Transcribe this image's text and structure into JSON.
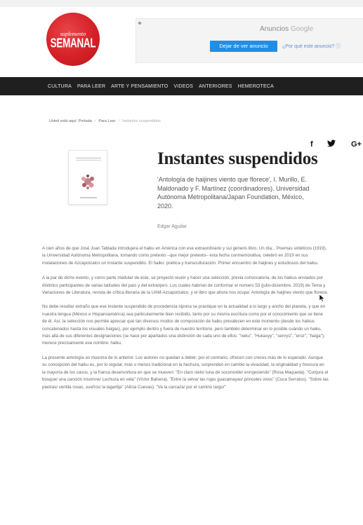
{
  "header": {
    "logo_sup": "suplemento",
    "logo_main": "SEMANAL"
  },
  "ad": {
    "title_prefix": "Anuncios ",
    "title_brand": "Google",
    "stop_button": "Dejar de ver anuncio",
    "why_link": "¿Por qué este anuncio? ⓘ"
  },
  "nav": {
    "items": [
      "CULTURA",
      "PARA LEER",
      "ARTE Y PENSAMIENTO",
      "VIDEOS",
      "ANTERIORES",
      "HEMEROTECA"
    ]
  },
  "breadcrumb": {
    "prefix": "Usted está aquí: Portada",
    "level1": "Para Leer",
    "current": "Instantes suspendidos"
  },
  "social": {
    "facebook": "f",
    "google_plus": "G+"
  },
  "article": {
    "title": "Instantes suspendidos",
    "subtitle": "'Antología de haijines viento que florece', I. Murillo, E. Maldonado y F. Martínez (coordinadores). Universidad Autónoma Metropolitana/Japan Foundation, México, 2020.",
    "author": "Edgar Aguilar",
    "paragraphs": [
      "A cien años de que José Juan Tablada introdujera el haiku en América con ese extraordinario y sui géneris libro, Un día... Poemas sintéticos (1919), la Universidad Autónoma Metropolitana, tomando como pretexto –que mejor pretexto– esta fecha conmemorativa, celebró en 2019 en sus instalaciones de Azcapotzalco un instante suspendido. El haiku: poética y transculturación. Primer encuentro de haijines y estudiosos del haiku.",
      "A la par de dicho evento, y como parte medular de éste, se proyectó reunir y hacer una selección, previa convocatoria, de los haikus enviados por distintos participantes de varias latitudes del país y del extranjero. Los cuales habrían de conformar el número 53 (julio-diciembre, 2019) de Tema y Variaciones de Literatura, revista de crítica literaria de la UAM-Azcapotzalco, y el libro que ahora nos ocupa: Antología de haijines viento que florece.",
      "No debe resultar extraño que ese instante suspendido de procedencia nipona se practique en la actualidad a lo largo y ancho del planeta, y que en nuestra lengua (México e Hispanoamérica) sea particularmente bien recibido, tanto por su misma escritura como por el conocimiento que se tiene de él. Así, la selección nos permite apreciar qué tan diversos modos de composición de haiku prevalecen en este momento (desde los haikus concatenados hasta los visuales haigas), por ejemplo dentro y fuera de nuestro territorio, pero también determinar en lo posible cuándo un haiku, más allá de sus diferentes designaciones (se hace por apartados una distinción de cada uno de ellos: \"neku\", \"Hukasyy\", \"senryū\", \"eroz\", \"haiga\"), merece precisamente ese nombre: haiku.",
      "La presente antología es muestra de lo anterior. Los autores no quedan a deber: por el contrario, ofrecen con creces más de lo esperado. Aunque su concepción del haiku es, por lo regular, más o menos tradicional en la hechura, sorprenden en cambio la vivacidad, la originalidad y frescura en la mayoría de los casos, y la franca desenvoltura en que se mueven: \"En claro cielo/ luna de soconoxtle/ enrojeciendo\" (Rosa Maqueda). \"Conjura el bosque/ una canción insomne/ Lechuza en vela\" (Víctor Bahena). \"Entre la selva/ las rojas guacamayas/ princeles vivos\" (Cuca Serratos). \"Sobre las piedras/ ventila rosas, sueños/ la lagartija\" (Alicia Cuevas). \"Va la carcaza/ por el camino largo/\""
    ]
  }
}
